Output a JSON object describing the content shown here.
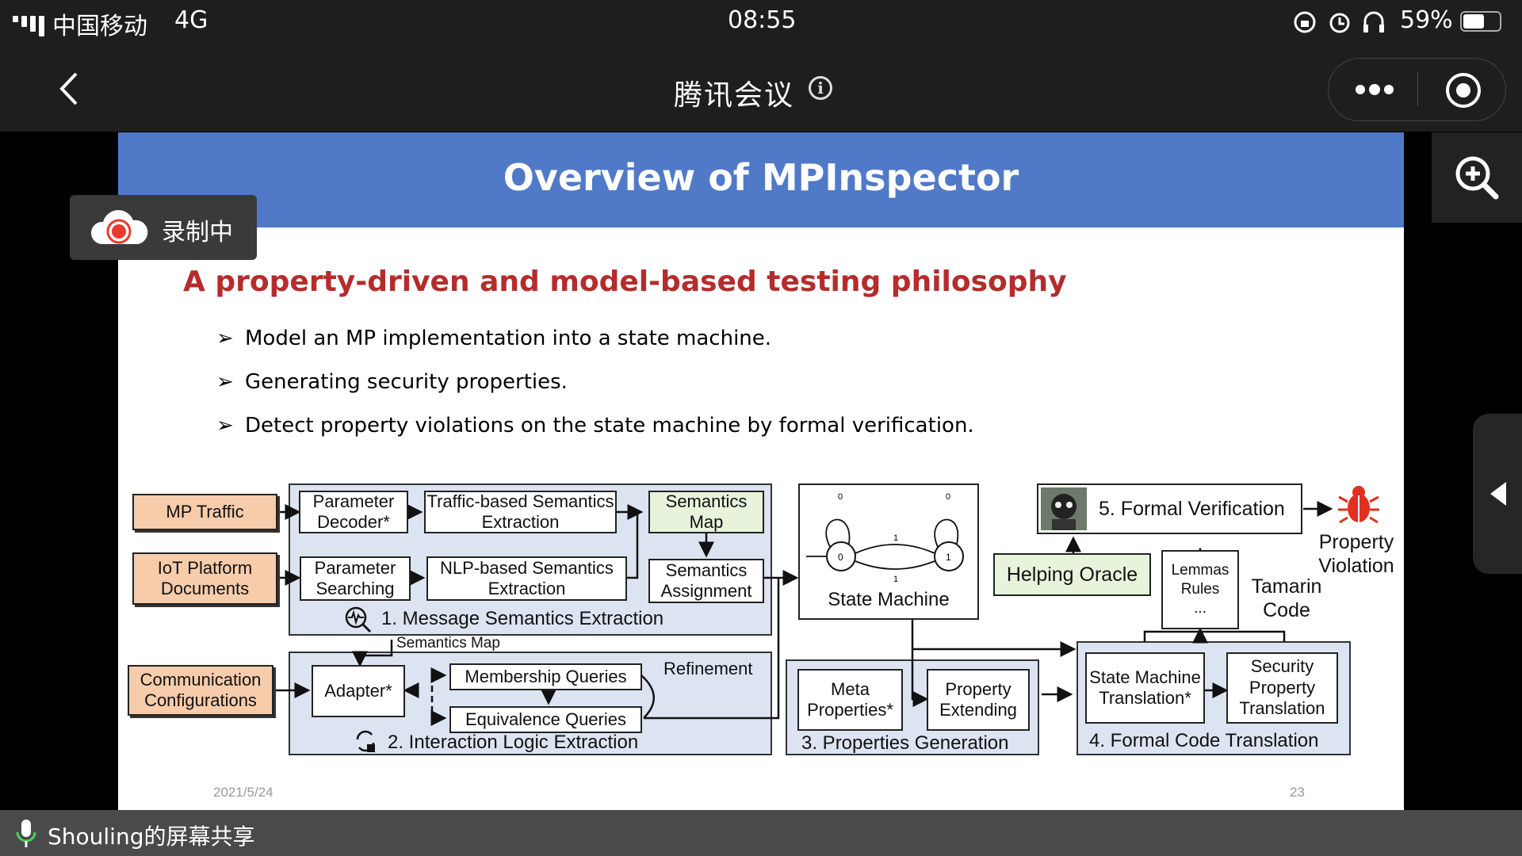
{
  "status_bar": {
    "carrier": "中国移动",
    "network": "4G",
    "time": "08:55",
    "battery": "59%",
    "battery_level": 0.59
  },
  "nav": {
    "title": "腾讯会议",
    "back_icon": "chevron-left-icon",
    "info_icon": "info-icon",
    "more_icon": "more-icon",
    "record_icon": "target-icon"
  },
  "recording": {
    "label": "录制中",
    "icon": "cloud-record-icon"
  },
  "share": {
    "label": "Shouling的屏幕共享",
    "icon": "microphone-icon"
  },
  "slide": {
    "title": "Overview of MPInspector",
    "subtitle": "A property-driven and model-based testing philosophy",
    "bullets": [
      "Model an MP implementation into a state machine.",
      "Generating security properties.",
      "Detect property violations on the state machine by formal verification."
    ],
    "footer_date": "2021/5/24",
    "page_number": "23",
    "diagram": {
      "inputs": {
        "mp_traffic": "MP Traffic",
        "iot_docs": "IoT Platform Documents",
        "comm_config": "Communication Configurations"
      },
      "parameter_decoder": "Parameter Decoder*",
      "traffic_extraction": "Traffic-based Semantics Extraction",
      "semantics_map": "Semantics Map",
      "parameter_searching": "Parameter Searching",
      "nlp_extraction": "NLP-based Semantics Extraction",
      "semantics_assignment": "Semantics Assignment",
      "stage1": "1. Message Semantics Extraction",
      "semantics_map_label": "Semantics Map",
      "adapter": "Adapter*",
      "membership_queries": "Membership Queries",
      "equivalence_queries": "Equivalence Queries",
      "refinement": "Refinement",
      "stage2": "2. Interaction Logic Extraction",
      "state_machine": "State Machine",
      "sm_state_0": "0",
      "sm_state_1": "1",
      "sm_edge": "1",
      "sm_loop": "0",
      "meta_properties": "Meta Properties*",
      "property_extending": "Property Extending",
      "stage3": "3. Properties Generation",
      "formal_verification": "5. Formal Verification",
      "helping_oracle": "Helping Oracle",
      "lemmas": "Lemmas",
      "rules": "Rules",
      "ellipsis": "...",
      "tamarin_code": "Tamarin Code",
      "property_violation": "Property Violation",
      "sm_translation": "State Machine Translation*",
      "sp_translation": "Security Property Translation",
      "stage4": "4. Formal Code Translation"
    }
  },
  "colors": {
    "header_blue": "#5079c8",
    "subtitle_red": "#b52c2c",
    "input_orange": "#f7ccaa",
    "group_blue": "#dce4f2",
    "green": "#e8f3dc",
    "bug_red": "#e0301e"
  }
}
